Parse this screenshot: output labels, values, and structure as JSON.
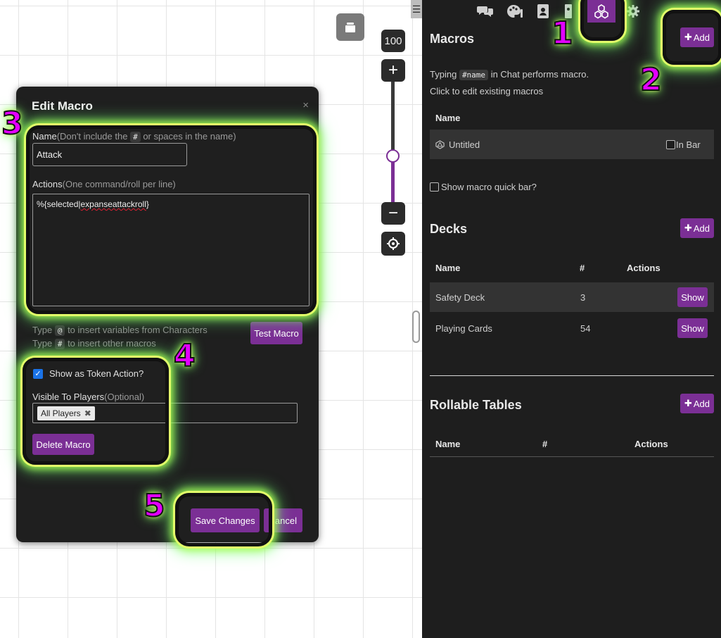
{
  "canvas": {
    "zoom_level": "100",
    "zoom_fraction": 0.62,
    "zoom_in_glyph": "+",
    "zoom_out_glyph": "−"
  },
  "panel": {
    "tabs": [
      {
        "icon": "chat-icon"
      },
      {
        "icon": "art-icon"
      },
      {
        "icon": "journal-icon"
      },
      {
        "icon": "compendium-icon"
      },
      {
        "icon": "macros-icon",
        "active": true
      },
      {
        "icon": "gear-icon"
      }
    ],
    "macros": {
      "title": "Macros",
      "add_label": "Add",
      "help_prefix": "Typing",
      "help_code": "#name",
      "help_suffix": "in Chat performs macro.",
      "help_line2": "Click to edit existing macros",
      "col_name": "Name",
      "rows": [
        {
          "name": "Untitled",
          "in_bar_label": "In Bar"
        }
      ],
      "quick_bar_label": "Show macro quick bar?"
    },
    "decks": {
      "title": "Decks",
      "add_label": "Add",
      "col_name": "Name",
      "col_count": "#",
      "col_actions": "Actions",
      "rows": [
        {
          "name": "Safety Deck",
          "count": "3",
          "action": "Show"
        },
        {
          "name": "Playing Cards",
          "count": "54",
          "action": "Show"
        }
      ]
    },
    "tables": {
      "title": "Rollable Tables",
      "add_label": "Add",
      "col_name": "Name",
      "col_count": "#",
      "col_actions": "Actions"
    }
  },
  "dialog": {
    "title": "Edit Macro",
    "close_glyph": "×",
    "name_label": "Name",
    "name_hint_prefix": "(Don't include the",
    "name_hint_code": "#",
    "name_hint_suffix": "or spaces in the name)",
    "name_value": "Attack",
    "actions_label": "Actions",
    "actions_hint": "(One command/roll per line)",
    "actions_value_start": "%{selected|",
    "actions_value_spell": "expanseattackroll",
    "actions_value_end": "}",
    "hint1_prefix": "Type",
    "hint1_code": "@",
    "hint1_suffix": "to insert variables from Characters",
    "hint2_prefix": "Type",
    "hint2_code": "#",
    "hint2_suffix": "to insert other macros",
    "test_label": "Test Macro",
    "token_action_label": "Show as Token Action?",
    "token_action_checked": true,
    "visible_label": "Visible To Players",
    "visible_hint": "(Optional)",
    "visible_chip": "All Players",
    "delete_label": "Delete Macro",
    "save_label": "Save Changes",
    "cancel_label": "Cancel"
  },
  "annotations": [
    "1",
    "2",
    "3",
    "4",
    "5"
  ],
  "colors": {
    "accent": "#7b2f95",
    "glow": "#e3ff6a",
    "annotation_number": "#e300ff",
    "panel_bg": "#1e1e1e"
  }
}
